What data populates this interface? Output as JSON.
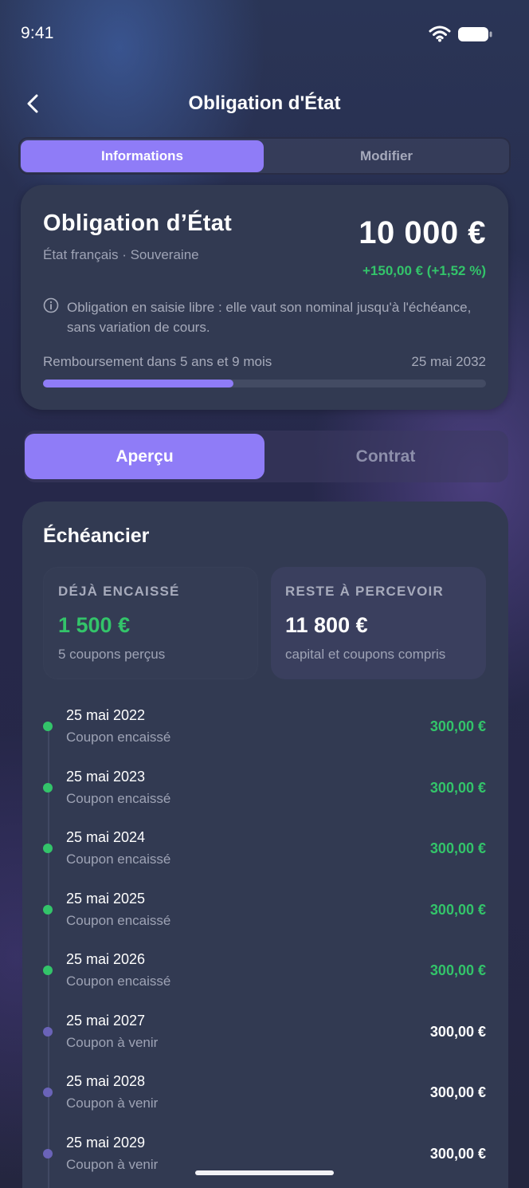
{
  "status_bar": {
    "time": "9:41"
  },
  "header": {
    "title": "Obligation d'État"
  },
  "top_tabs": [
    {
      "label": "Informations",
      "active": true
    },
    {
      "label": "Modifier",
      "active": false
    }
  ],
  "summary": {
    "name": "Obligation d’État",
    "subtitle": "État français · Souveraine",
    "value": "10 000 €",
    "change": "+150,00 € (+1,52 %)",
    "info": "Obligation en saisie libre : elle vaut son nominal jusqu'à l'échéance, sans variation de cours.",
    "repayment_label": "Remboursement dans 5 ans et 9 mois",
    "maturity_date": "25 mai 2032",
    "progress_fraction": 0.43
  },
  "section_tabs": [
    {
      "label": "Aperçu",
      "active": true
    },
    {
      "label": "Contrat",
      "active": false
    }
  ],
  "schedule": {
    "title": "Échéancier",
    "collected": {
      "label": "DÉJÀ ENCAISSÉ",
      "value": "1 500 €",
      "sub": "5 coupons perçus"
    },
    "remaining": {
      "label": "RESTE À PERCEVOIR",
      "value": "11 800 €",
      "sub": "capital et coupons compris"
    },
    "items": [
      {
        "date": "25 mai 2022",
        "status": "Coupon encaissé",
        "amount": "300,00 €",
        "paid": true
      },
      {
        "date": "25 mai 2023",
        "status": "Coupon encaissé",
        "amount": "300,00 €",
        "paid": true
      },
      {
        "date": "25 mai 2024",
        "status": "Coupon encaissé",
        "amount": "300,00 €",
        "paid": true
      },
      {
        "date": "25 mai 2025",
        "status": "Coupon encaissé",
        "amount": "300,00 €",
        "paid": true
      },
      {
        "date": "25 mai 2026",
        "status": "Coupon encaissé",
        "amount": "300,00 €",
        "paid": true
      },
      {
        "date": "25 mai 2027",
        "status": "Coupon à venir",
        "amount": "300,00 €",
        "paid": false
      },
      {
        "date": "25 mai 2028",
        "status": "Coupon à venir",
        "amount": "300,00 €",
        "paid": false
      },
      {
        "date": "25 mai 2029",
        "status": "Coupon à venir",
        "amount": "300,00 €",
        "paid": false
      }
    ]
  },
  "colors": {
    "accent": "#8f7cf7",
    "positive": "#33c46a",
    "upcoming_dot": "#6a63b8",
    "card": "#323a52"
  },
  "icons": {
    "back": "chevron-left-icon",
    "wifi": "wifi-icon",
    "battery": "battery-icon",
    "info": "info-circle-icon"
  }
}
